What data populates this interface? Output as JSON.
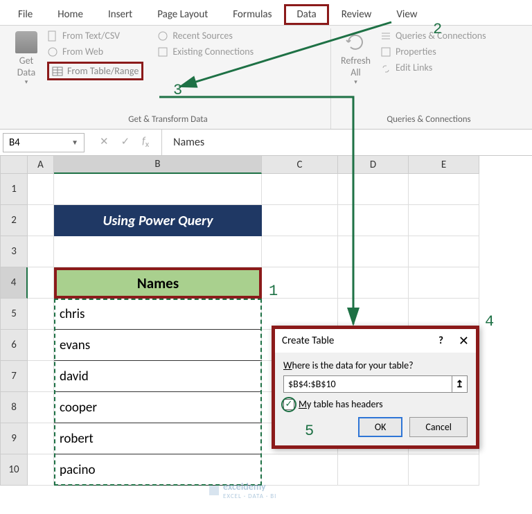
{
  "tabs": {
    "file": "File",
    "home": "Home",
    "insert": "Insert",
    "page_layout": "Page Layout",
    "formulas": "Formulas",
    "data": "Data",
    "review": "Review",
    "view": "View"
  },
  "ribbon": {
    "get_data": "Get\nData",
    "from_text_csv": "From Text/CSV",
    "from_web": "From Web",
    "from_table_range": "From Table/Range",
    "recent_sources": "Recent Sources",
    "existing_connections": "Existing Connections",
    "group1_label": "Get & Transform Data",
    "refresh_all": "Refresh\nAll",
    "queries_conn": "Queries & Connections",
    "properties": "Properties",
    "edit_links": "Edit Links",
    "group2_label": "Queries & Connections"
  },
  "name_box": "B4",
  "formula_value": "Names",
  "columns": [
    "A",
    "B",
    "C",
    "D",
    "E"
  ],
  "rows": [
    "1",
    "2",
    "3",
    "4",
    "5",
    "6",
    "7",
    "8",
    "9",
    "10"
  ],
  "banner": "Using Power Query",
  "table": {
    "header": "Names",
    "data": [
      "chris",
      "evans",
      "david",
      "cooper",
      "robert",
      "pacino"
    ]
  },
  "dialog": {
    "title": "Create Table",
    "help": "?",
    "prompt_pre": "W",
    "prompt_rest": "here is the data for your table?",
    "range": "$B$4:$B$10",
    "checkbox_pre": "M",
    "checkbox_rest": "y table has headers",
    "ok": "OK",
    "cancel": "Cancel"
  },
  "annotations": {
    "n1": "1",
    "n2": "2",
    "n3": "3",
    "n4": "4",
    "n5": "5"
  },
  "watermark": {
    "brand": "exceldemy",
    "sub": "EXCEL · DATA · BI"
  }
}
